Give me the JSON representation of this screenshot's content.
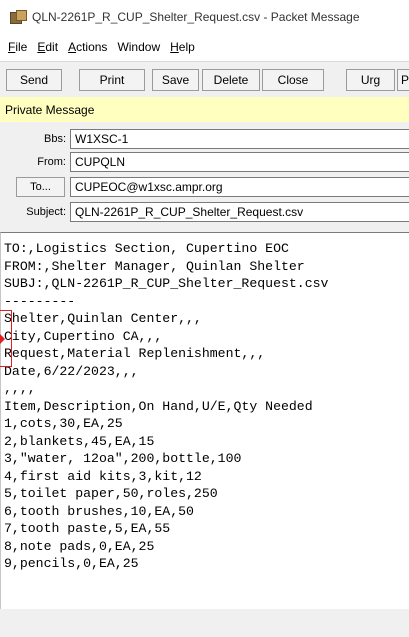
{
  "window": {
    "title": "QLN-2261P_R_CUP_Shelter_Request.csv - Packet Message"
  },
  "menu": [
    {
      "pre": "",
      "mn": "F",
      "post": "ile"
    },
    {
      "pre": "",
      "mn": "E",
      "post": "dit"
    },
    {
      "pre": "",
      "mn": "A",
      "post": "ctions"
    },
    {
      "pre": "Window",
      "mn": "",
      "post": ""
    },
    {
      "pre": "",
      "mn": "H",
      "post": "elp"
    }
  ],
  "toolbar": {
    "send": "Send",
    "print": "Print",
    "save": "Save",
    "delete": "Delete",
    "close": "Close",
    "urg": "Urg",
    "pv": "Pv"
  },
  "message_type": "Private Message",
  "header": {
    "bbs_label": "Bbs:",
    "bbs_value": "W1XSC-1",
    "from_label": "From:",
    "from_value": "CUPQLN",
    "to_button": "To...",
    "to_value": "CUPEOC@w1xsc.ampr.org",
    "subject_label": "Subject:",
    "subject_value": "QLN-2261P_R_CUP_Shelter_Request.csv"
  },
  "body_lines": [
    "TO:,Logistics Section, Cupertino EOC",
    "FROM:,Shelter Manager, Quinlan Shelter",
    "SUBJ:,QLN-2261P_R_CUP_Shelter_Request.csv",
    "---------",
    "Shelter,Quinlan Center,,,",
    "City,Cupertino CA,,,",
    "Request,Material Replenishment,,,",
    "Date,6/22/2023,,,",
    ",,,,",
    "Item,Description,On Hand,U/E,Qty Needed",
    "1,cots,30,EA,25",
    "2,blankets,45,EA,15",
    "3,\"water, 12oa\",200,bottle,100",
    "4,first aid kits,3,kit,12",
    "5,toilet paper,50,roles,250",
    "6,tooth brushes,10,EA,50",
    "7,tooth paste,5,EA,55",
    "8,note pads,0,EA,25",
    "9,pencils,0,EA,25"
  ],
  "colors": {
    "private_bar": "#ffffc0",
    "annotation": "#e02020"
  }
}
